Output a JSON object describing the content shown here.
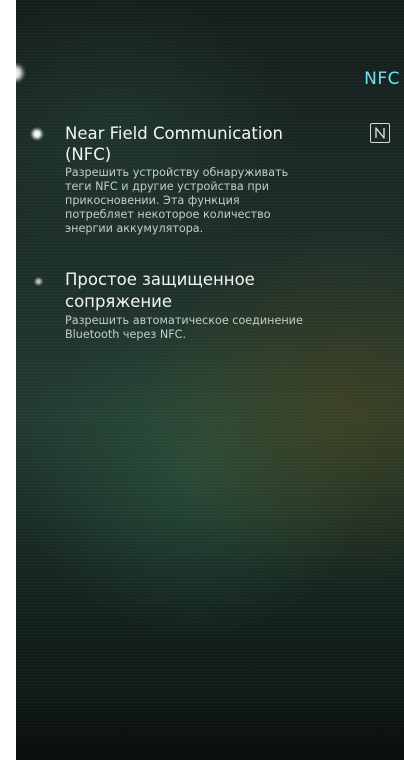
{
  "header": {
    "title": "NFC",
    "back_icon": "back-glow-icon",
    "accent_color": "#6fe3f0"
  },
  "settings": [
    {
      "title_line1": "Near Field Communication",
      "title_line2": "(NFC)",
      "description_lines": [
        "Разрешить устройству обнаруживать",
        "теги NFC и другие устройства при",
        "прикосновении. Эта функция",
        "потребляет некоторое количество",
        "энергии аккумулятора."
      ],
      "enabled": true,
      "badge_icon": "nfc-n-icon"
    },
    {
      "title_line1": "Простое защищенное",
      "title_line2": "сопряжение",
      "description_lines": [
        "Разрешить автоматическое соединение",
        "Bluetooth через NFC."
      ],
      "enabled": false
    }
  ]
}
